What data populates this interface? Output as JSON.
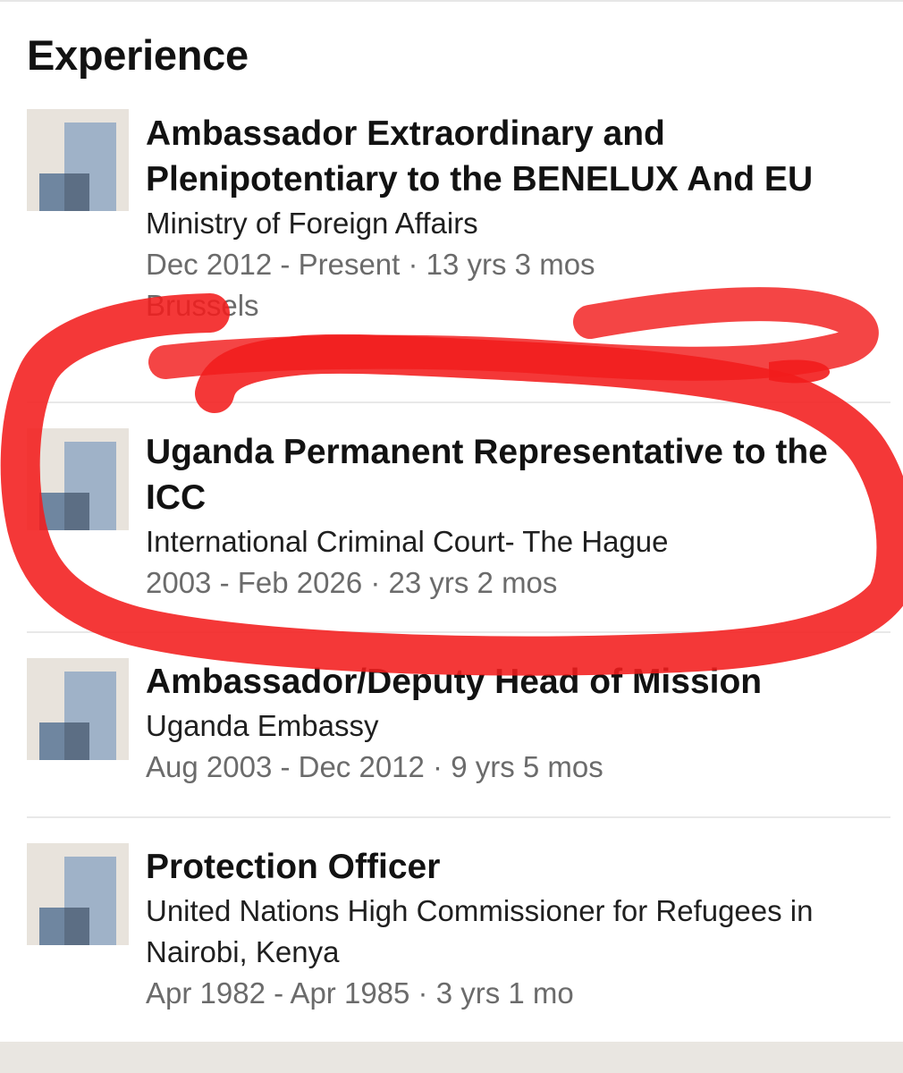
{
  "section": {
    "title": "Experience"
  },
  "entries": [
    {
      "title": "Ambassador Extraordinary and Plenipotentiary to the BENELUX And EU",
      "company": "Ministry of Foreign Affairs",
      "dates": "Dec 2012 - Present · 13 yrs 3 mos",
      "location": "Brussels"
    },
    {
      "title": "Uganda Permanent Representative to the ICC",
      "company": "International Criminal Court- The Hague",
      "dates": "2003 - Feb 2026 · 23 yrs 2 mos"
    },
    {
      "title": "Ambassador/Deputy Head of Mission",
      "company": "Uganda Embassy",
      "dates": "Aug 2003 - Dec 2012 · 9 yrs 5 mos"
    },
    {
      "title": "Protection Officer",
      "company": "United Nations High Commissioner for Refugees in Nairobi, Kenya",
      "dates": "Apr 1982 - Apr 1985 · 3 yrs 1 mo"
    }
  ],
  "colors": {
    "page_background": "#ffffff",
    "outer_background": "#e9e6e1",
    "title_text": "#121212",
    "secondary_text": "#6b6b6b",
    "logo_background": "#e8e3dc",
    "logo_light_bar": "#9fb2c8",
    "logo_dark_bar": "#6f86a0",
    "annotation_marker": "#f21c1c"
  },
  "icons": {
    "company_logo": "building-placeholder-icon"
  }
}
